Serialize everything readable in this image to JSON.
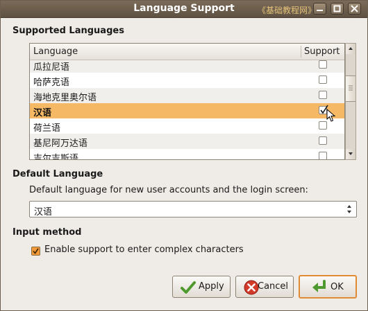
{
  "window": {
    "title": "Language Support",
    "watermark": "《基础教程网》"
  },
  "supported": {
    "section_title": "Supported Languages",
    "columns": {
      "language": "Language",
      "support": "Support"
    },
    "rows": [
      {
        "name": "瓜拉尼语",
        "checked": false,
        "selected": false
      },
      {
        "name": "哈萨克语",
        "checked": false,
        "selected": false
      },
      {
        "name": "海地克里奥尔语",
        "checked": false,
        "selected": false
      },
      {
        "name": "汉语",
        "checked": true,
        "selected": true
      },
      {
        "name": "荷兰语",
        "checked": false,
        "selected": false
      },
      {
        "name": "基尼阿万达语",
        "checked": false,
        "selected": false
      },
      {
        "name": "吉尔吉斯语",
        "checked": false,
        "selected": false
      }
    ]
  },
  "default_language": {
    "section_title": "Default Language",
    "description": "Default language for new user accounts and the login screen:",
    "selected": "汉语"
  },
  "input_method": {
    "section_title": "Input method",
    "checkbox_label": "Enable support to enter complex characters",
    "checked": true
  },
  "buttons": {
    "apply": "Apply",
    "cancel": "Cancel",
    "ok": "OK"
  },
  "colors": {
    "selection": "#f5b865",
    "accent": "#f29a3b",
    "titlebar": "#6b5e4f"
  }
}
